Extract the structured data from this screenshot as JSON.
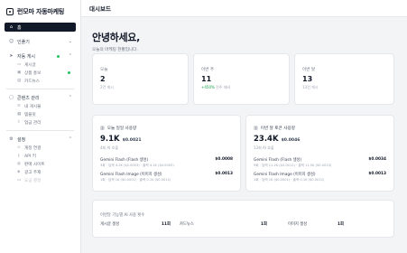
{
  "app": {
    "title": "런모마 자동마케팅"
  },
  "sidebar": {
    "home": "홈",
    "groups": [
      {
        "label": "인플기",
        "items": []
      },
      {
        "label": "자동 게시",
        "items": [
          "게시글",
          "상품 홍보",
          "카드뉴스"
        ]
      },
      {
        "label": "콘텐츠 관리",
        "items": [
          "내 게시물",
          "템플릿",
          "업금 관리"
        ]
      },
      {
        "label": "설정",
        "items": [
          "계정 연결",
          "API 키",
          "판매 사이트",
          "광고 주제",
          "요금 결정"
        ]
      }
    ]
  },
  "header": {
    "title": "대시보드"
  },
  "greeting": {
    "title": "안녕하세요,",
    "subtitle": "오늘의 마케팅 현황입니다."
  },
  "stats": [
    {
      "label": "오늘",
      "value": "2",
      "sub": "2건 게시",
      "change": ""
    },
    {
      "label": "이번 주",
      "value": "11",
      "sub": "전주 대비",
      "change": "+450%"
    },
    {
      "label": "이번 달",
      "value": "13",
      "sub": "13건 게시",
      "change": ""
    }
  ],
  "usage_today": {
    "title": "오늘 일일 사용량",
    "count": "9.1K",
    "cost": "$0.0021",
    "calls": "4회 AI 호출",
    "models": [
      {
        "name": "Gemini Flash (Flash 생성)",
        "amount": "$0.0008",
        "detail": "3회 · 입력 4.2K ($0.0003) · 출력 4.1K ($0.0005)"
      },
      {
        "name": "Gemini Flash Image (이미지 생성)",
        "amount": "$0.0013",
        "detail": "1회 · 입력 1K ($0.0001) · 출력 0.1K ($0.0012)"
      }
    ]
  },
  "usage_month": {
    "title": "이번 달 토큰 사용량",
    "count": "23.4K",
    "cost": "$0.0046",
    "calls": "13회 AI 호출",
    "models": [
      {
        "name": "Gemini Flash (Flash 생성)",
        "amount": "$0.0034",
        "detail": "9회 · 입력 11.2K ($0.0011) · 출력 11.5K ($0.0023)"
      },
      {
        "name": "Gemini Flash Image (이미지 생성)",
        "amount": "$0.0013",
        "detail": "1회 · 입력 1K ($0.0001) · 출력 0.1K ($0.0012)"
      }
    ]
  },
  "breakdown": {
    "title": "이번달 기능별 AI 사용 횟수",
    "items": [
      {
        "label": "게시글 생성",
        "count": "11회"
      },
      {
        "label": "카드뉴스",
        "count": "1회"
      },
      {
        "label": "이미지 생성",
        "count": "1회"
      }
    ]
  }
}
